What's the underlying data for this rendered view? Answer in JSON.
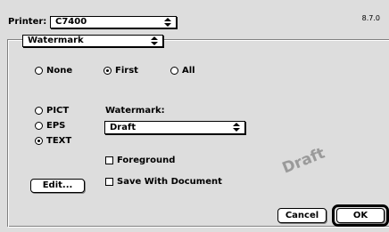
{
  "version": "8.7.0",
  "printer": {
    "label": "Printer:",
    "value": "C7400"
  },
  "section_popup": {
    "value": "Watermark"
  },
  "position_options": [
    {
      "label": "None",
      "selected": false
    },
    {
      "label": "First",
      "selected": true
    },
    {
      "label": "All",
      "selected": false
    }
  ],
  "type_options": [
    {
      "label": "PICT",
      "selected": false
    },
    {
      "label": "EPS",
      "selected": false
    },
    {
      "label": "TEXT",
      "selected": true
    }
  ],
  "watermark": {
    "label": "Watermark:",
    "value": "Draft"
  },
  "foreground": {
    "label": "Foreground",
    "checked": false
  },
  "save_with_document": {
    "label": "Save With Document",
    "checked": false
  },
  "edit_button": "Edit...",
  "preview_text": "Draft",
  "cancel_button": "Cancel",
  "ok_button": "OK"
}
